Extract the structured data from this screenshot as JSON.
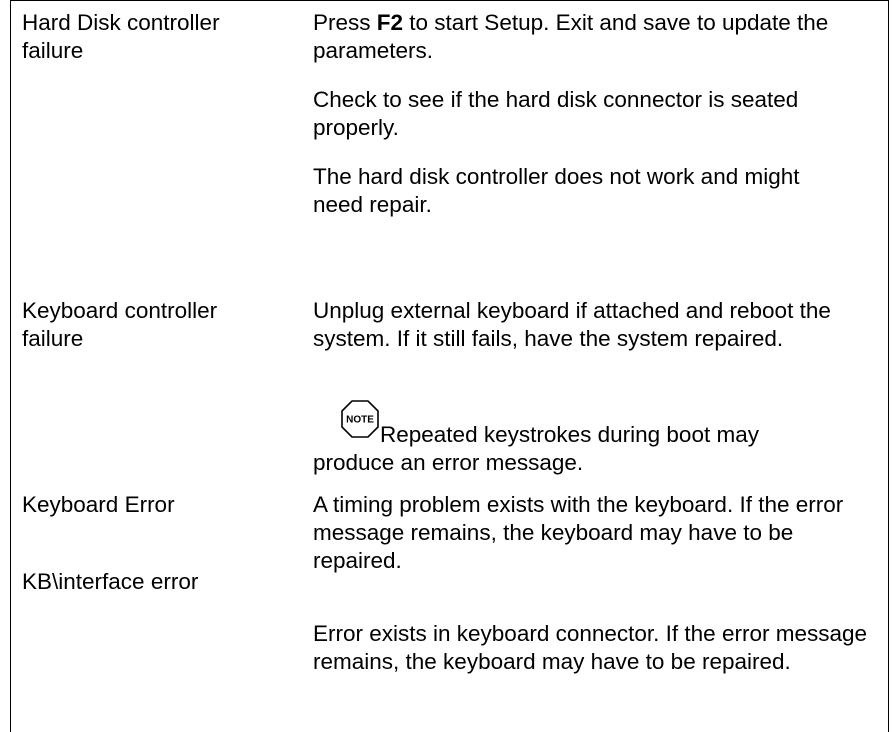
{
  "rows": [
    {
      "error": "Hard Disk controller failure",
      "solution_p1_pre": "Press ",
      "solution_p1_key": "F2",
      "solution_p1_post": " to start Setup. Exit and save to update the parameters.",
      "solution_p2": "Check to see if the hard disk connector is seated properly.",
      "solution_p3": "The hard disk controller does not work and might need repair."
    },
    {
      "error": "Keyboard controller failure",
      "solution_p1": "Unplug external keyboard if attached and reboot the system. If it still fails, have the system repaired.",
      "note_icon_label": "NOTE",
      "note_line1": "Repeated keystrokes during boot may",
      "note_line2": "produce an error message."
    },
    {
      "error": "Keyboard Error",
      "solution_p1": "A timing problem exists with the keyboard. If the error message remains, the keyboard may have to be repaired."
    },
    {
      "error": "KB\\interface error",
      "solution_p1": "Error exists in keyboard connector. If the error message remains, the keyboard may have to be repaired."
    }
  ]
}
